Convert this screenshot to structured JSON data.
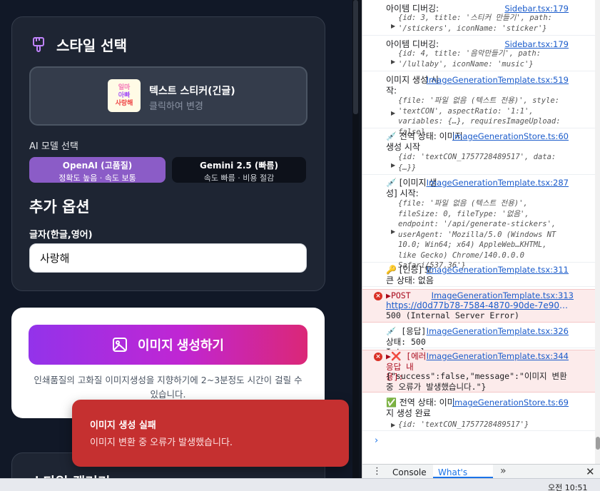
{
  "app": {
    "style_section": {
      "title": "스타일 선택",
      "selected_style_name": "텍스트 스티커(긴글)",
      "selected_style_hint": "클릭하여 변경",
      "sticker_lines": [
        "일마",
        "아빠",
        "사랑해"
      ]
    },
    "model_section": {
      "label": "AI 모델 선택",
      "options": [
        {
          "title": "OpenAI (고품질)",
          "subtitle": "정확도 높음 · 속도 보통",
          "selected": true
        },
        {
          "title": "Gemini 2.5 (빠름)",
          "subtitle": "속도 빠름 · 비용 절감",
          "selected": false
        }
      ]
    },
    "extra_options": {
      "title": "추가 옵션",
      "text_label": "글자(한글,영어)",
      "text_value": "사랑해"
    },
    "generate": {
      "button_label": "이미지 생성하기",
      "note": "인쇄품질의 고화질 이미지생성을 지향하기에 2~3분정도 시간이 걸릴 수 있습니다."
    },
    "next_section_title": "스타일 갤러리",
    "toast": {
      "title": "이미지 생성 실패",
      "message": "이미지 변환 중 오류가 발생했습니다."
    }
  },
  "devtools": {
    "logs": [
      {
        "text": "아이템 디버깅:",
        "source": "Sidebar.tsx:179",
        "obj": "{id: 3, title: '스티커 만들기', path: '/stickers', iconName: 'sticker'}"
      },
      {
        "text": "아이템 디버깅:",
        "source": "Sidebar.tsx:179",
        "obj": "{id: 4, title: '음악만들기', path: '/lullaby', iconName: 'music'}"
      },
      {
        "text": "이미지 생성 시작:",
        "source": "ImageGenerationTemplate.tsx:519",
        "obj": "{file: '파일 없음 (텍스트 전용)', style: 'textCON', aspectRatio: '1:1', variables: {…}, requiresImageUpload: false}"
      },
      {
        "text": "💉 전역 상태: 이미지 생성 시작",
        "source": "imageGenerationStore.ts:60",
        "obj": "{id: 'textCON_1757728489517', data: {…}}"
      },
      {
        "text": "💉 [이미지 생성] 시작:",
        "source": "ImageGenerationTemplate.tsx:287",
        "obj": "{file: '파일 없음 (텍스트 전용)', fileSize: 0, fileType: '없음', endpoint: '/api/generate-stickers', userAgent: 'Mozilla/5.0 (Windows NT 10.0; Win64; x64) AppleWeb…KHTML, like Gecko) Chrome/140.0.0.0 Safari/537.36'}"
      },
      {
        "text": "🔑 [인증] 토큰 상태: 없음",
        "source": "ImageGenerationTemplate.tsx:311",
        "obj": ""
      },
      {
        "text": "POST",
        "url": "https://d0d77b78-7584-4870-90de-7e90bf483…",
        "status_line": "500 (Internal Server Error)",
        "source": "ImageGenerationTemplate.tsx:313"
      },
      {
        "text": "💉 [응답] 상태: 500 Internal Server Error",
        "source": "ImageGenerationTemplate.tsx:326"
      },
      {
        "text": "❌ [에러 응답 내용]:",
        "body": "{\"success\":false,\"message\":\"이미지 변환 중 오류가 발생했습니다.\"}",
        "source": "ImageGenerationTemplate.tsx:344"
      },
      {
        "text": "✅ 전역 상태: 이미지 생성 완료",
        "source": "imageGenerationStore.ts:69",
        "obj": "{id: 'textCON_1757728489517'}"
      }
    ],
    "drawer_tabs": [
      "Console",
      "What's new"
    ]
  },
  "taskbar": {
    "clock": "오전 10:51"
  },
  "colors": {
    "accent": "#8b5cc7",
    "toast": "#c53030",
    "error_bg": "#fcebeb"
  }
}
